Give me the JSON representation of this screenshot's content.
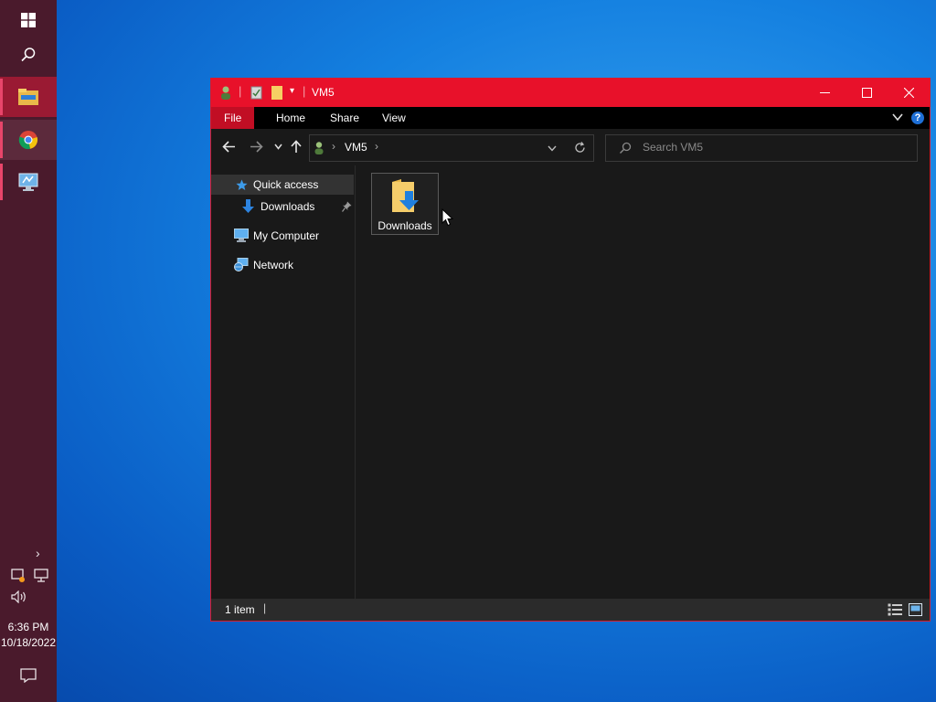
{
  "window": {
    "title": "VM5",
    "ribbon_tabs": [
      "File",
      "Home",
      "Share",
      "View"
    ],
    "help_label": "?",
    "address": {
      "crumb": "VM5"
    },
    "search": {
      "placeholder": "Search VM5"
    }
  },
  "navpane": {
    "items": [
      {
        "label": "Quick access",
        "icon": "star-icon"
      },
      {
        "label": "Downloads",
        "icon": "download-arrow-icon",
        "pinned": true
      },
      {
        "label": "My Computer",
        "icon": "computer-icon"
      },
      {
        "label": "Network",
        "icon": "network-icon"
      }
    ]
  },
  "content": {
    "items": [
      {
        "label": "Downloads",
        "icon": "downloads-folder-icon"
      }
    ]
  },
  "status": {
    "count": "1 item"
  },
  "taskbar": {
    "apps": [
      "windows-start-icon",
      "search-icon",
      "file-explorer-icon",
      "chrome-icon",
      "remote-desktop-icon"
    ],
    "time": "6:36 PM",
    "date": "10/18/2022"
  },
  "colors": {
    "titlebar": "#e8112a",
    "file_tab": "#c10e24",
    "taskbar": "#4a1a2c",
    "accent": "#0078d7"
  }
}
